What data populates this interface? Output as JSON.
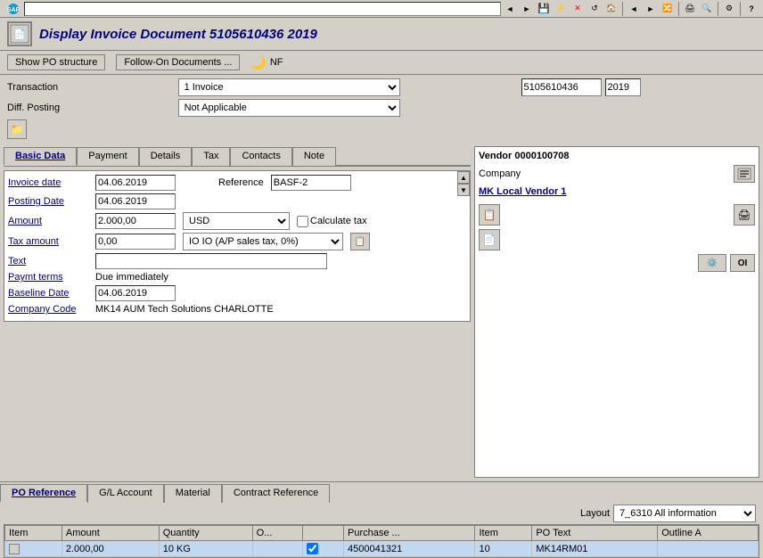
{
  "toolbar": {
    "address": ""
  },
  "title": {
    "text": "Display Invoice Document 5105610436 2019",
    "icon": "sap-icon"
  },
  "actions": {
    "show_po": "Show PO structure",
    "follow_on": "Follow-On Documents ...",
    "nf": "NF"
  },
  "form": {
    "transaction_label": "Transaction",
    "transaction_value": "1 Invoice",
    "diff_posting_label": "Diff. Posting",
    "diff_posting_value": "Not Applicable",
    "doc_number": "5105610436",
    "doc_year": "2019"
  },
  "tabs": {
    "items": [
      "Basic Data",
      "Payment",
      "Details",
      "Tax",
      "Contacts",
      "Note"
    ],
    "active": "Basic Data"
  },
  "invoice": {
    "date_label": "Invoice date",
    "date_value": "04.06.2019",
    "posting_date_label": "Posting Date",
    "posting_date_value": "04.06.2019",
    "amount_label": "Amount",
    "amount_value": "2.000,00",
    "tax_amount_label": "Tax amount",
    "tax_amount_value": "0,00",
    "text_label": "Text",
    "text_value": "",
    "paymt_terms_label": "Paymt terms",
    "paymt_terms_value": "Due immediately",
    "baseline_date_label": "Baseline Date",
    "baseline_date_value": "04.06.2019",
    "company_code_label": "Company Code",
    "company_code_value": "MK14 AUM Tech Solutions CHARLOTTE",
    "reference_label": "Reference",
    "reference_value": "BASF-2",
    "currency": "USD",
    "tax_code": "IO IO (A/P sales tax, 0%)",
    "calculate_tax": "Calculate tax"
  },
  "vendor": {
    "title": "Vendor 0000100708",
    "company_label": "Company",
    "name": "MK Local Vendor 1"
  },
  "bottom_tabs": {
    "items": [
      "PO Reference",
      "G/L Account",
      "Material",
      "Contract Reference"
    ],
    "active": "PO Reference"
  },
  "table": {
    "layout_label": "Layout",
    "layout_value": "7_6310 All information",
    "columns": [
      "Item",
      "Amount",
      "Quantity",
      "O...",
      "",
      "Purchase ...",
      "Item",
      "PO Text",
      "Outline A"
    ],
    "rows": [
      {
        "item": "",
        "amount": "2.000,00",
        "quantity": "10 KG",
        "o": "",
        "check": "",
        "purchase": "4500041321",
        "po_item": "10",
        "po_text": "MK14RM01",
        "outline": ""
      }
    ]
  },
  "icons": {
    "back": "◄",
    "forward": "►",
    "save": "💾",
    "print": "🖨",
    "find": "🔍",
    "help": "?",
    "arrow_up": "▲",
    "arrow_down": "▼",
    "arrow_left": "◄",
    "arrow_right": "►"
  }
}
